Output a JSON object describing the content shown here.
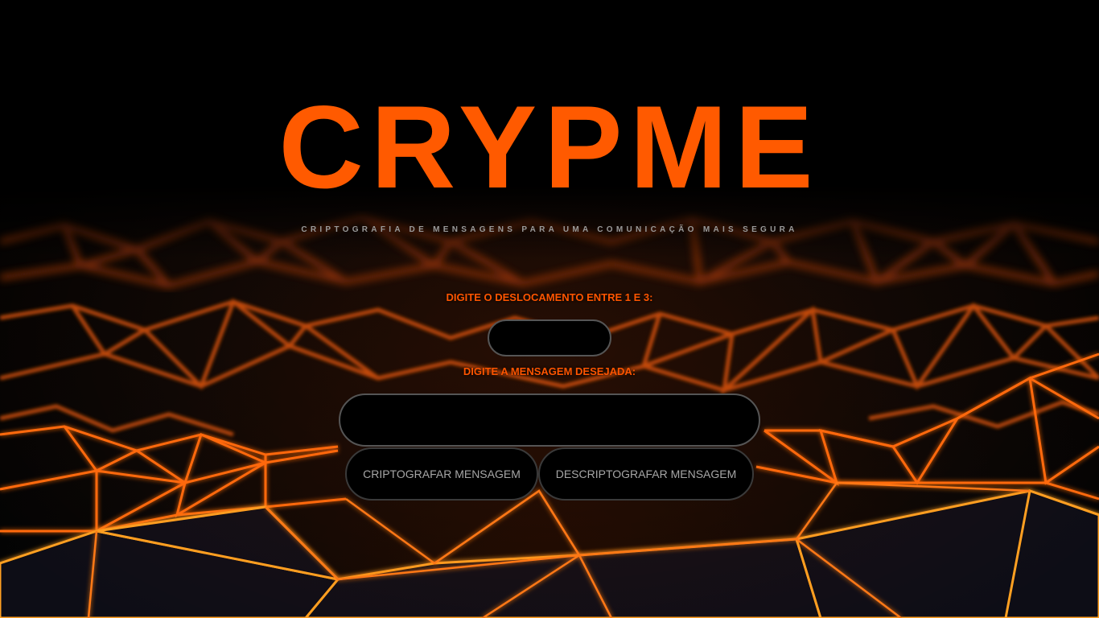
{
  "app": {
    "title": "CRYPME",
    "subtitle": "CRIPTOGRAFIA DE MENSAGENS PARA UMA COMUNICAÇÃO MAIS SEGURA"
  },
  "form": {
    "shift_label": "DIGITE O DESLOCAMENTO ENTRE 1 E 3:",
    "shift_value": "",
    "message_label": "DIGITE A MENSAGEM DESEJADA:",
    "message_value": ""
  },
  "buttons": {
    "encrypt_label": "CRIPTOGRAFAR MENSAGEM",
    "decrypt_label": "DESCRIPTOGRAFAR MENSAGEM"
  },
  "background": {
    "image": "orange-neon-low-poly-mesh"
  },
  "colors": {
    "accent": "#ff5a00",
    "label": "#ff5500",
    "subtitle": "#9a9a9a",
    "button_text": "#a6a6a6",
    "field_bg": "#000000"
  }
}
